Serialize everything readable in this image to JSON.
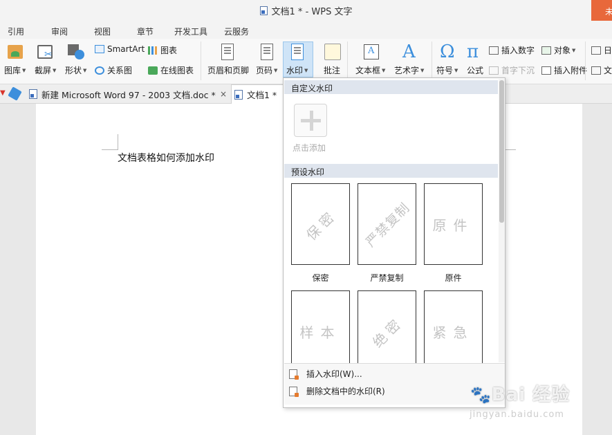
{
  "window": {
    "title": "文档1 * - WPS 文字",
    "badge": "未"
  },
  "menu": {
    "tabs": [
      "引用",
      "审阅",
      "视图",
      "章节",
      "开发工具",
      "云服务"
    ]
  },
  "ribbon": {
    "gallery": "图库",
    "screenshot": "截屏",
    "shapes": "形状",
    "smartart": "SmartArt",
    "chart": "图表",
    "relation": "关系图",
    "online_chart": "在线图表",
    "header_footer": "页眉和页脚",
    "page_number": "页码",
    "watermark": "水印",
    "comment": "批注",
    "textbox": "文本框",
    "wordart": "艺术字",
    "symbol": "符号",
    "formula": "公式",
    "insert_number": "插入数字",
    "object": "对象",
    "drop_cap": "首字下沉",
    "attachment": "插入附件",
    "date_partial": "日",
    "doc_partial": "文"
  },
  "doc_tabs": [
    {
      "label": "新建 Microsoft Word 97 - 2003 文档.doc *",
      "close": "×"
    },
    {
      "label": "文档1 *",
      "close": "×"
    }
  ],
  "document": {
    "body_text": "文档表格如何添加水印"
  },
  "watermark_menu": {
    "custom_header": "自定义水印",
    "add_label": "点击添加",
    "preset_header": "预设水印",
    "presets": [
      {
        "sample": "保密",
        "caption": "保密"
      },
      {
        "sample": "严禁复制",
        "caption": "严禁复制"
      },
      {
        "sample": "原件",
        "caption": "原件"
      },
      {
        "sample": "样本",
        "caption": ""
      },
      {
        "sample": "绝密",
        "caption": ""
      },
      {
        "sample": "紧急",
        "caption": ""
      }
    ],
    "insert_item": "插入水印(W)...",
    "remove_item": "删除文档中的水印(R)"
  },
  "site_watermark": {
    "logo_text": "Bai 经验",
    "url": "jingyan.baidu.com"
  },
  "colors": {
    "accent": "#3d8fdc",
    "active_button": "#cfe4f7",
    "section_header": "#dfe5ee",
    "badge": "#e8683b"
  }
}
